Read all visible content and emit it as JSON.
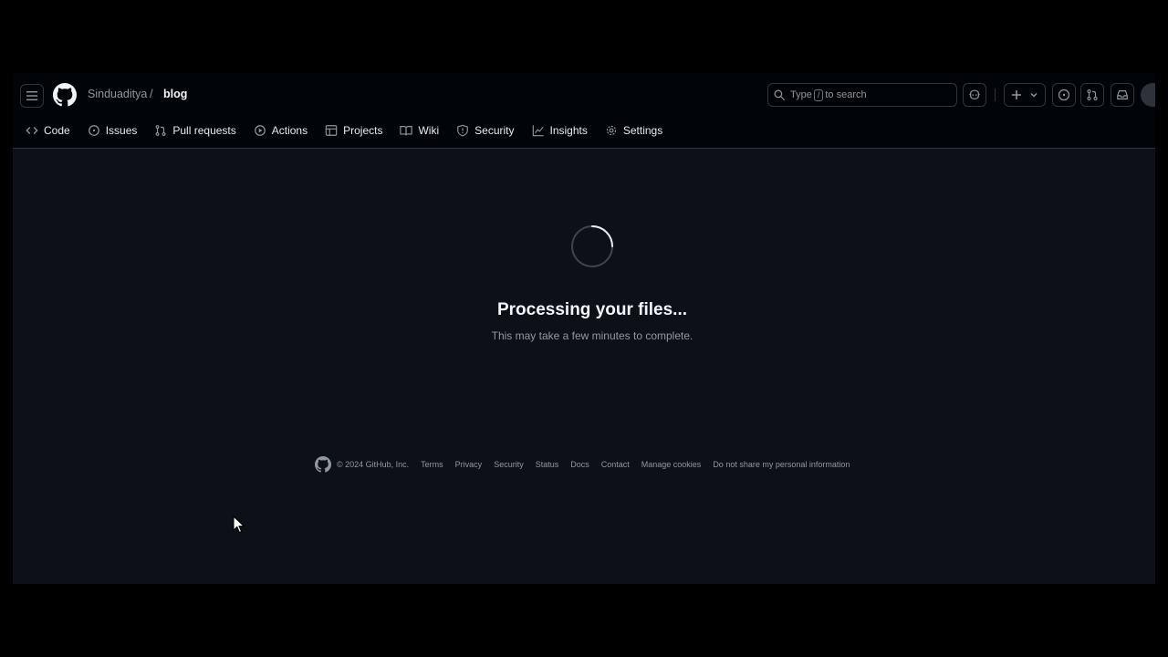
{
  "header": {
    "owner": "Sinduaditya",
    "separator": "/",
    "repo": "blog",
    "search": {
      "prefix": "Type",
      "key": "/",
      "suffix": "to search"
    }
  },
  "tabs": [
    {
      "label": "Code",
      "icon": "code-icon"
    },
    {
      "label": "Issues",
      "icon": "issue-icon"
    },
    {
      "label": "Pull requests",
      "icon": "pull-request-icon"
    },
    {
      "label": "Actions",
      "icon": "play-icon"
    },
    {
      "label": "Projects",
      "icon": "table-icon"
    },
    {
      "label": "Wiki",
      "icon": "book-icon"
    },
    {
      "label": "Security",
      "icon": "shield-icon"
    },
    {
      "label": "Insights",
      "icon": "graph-icon"
    },
    {
      "label": "Settings",
      "icon": "gear-icon"
    }
  ],
  "main": {
    "title": "Processing your files...",
    "subtitle": "This may take a few minutes to complete."
  },
  "footer": {
    "copyright": "© 2024 GitHub, Inc.",
    "links": [
      "Terms",
      "Privacy",
      "Security",
      "Status",
      "Docs",
      "Contact",
      "Manage cookies",
      "Do not share my personal information"
    ]
  },
  "colors": {
    "background": "#0d1117",
    "header_background": "#010409",
    "border": "#30363d",
    "muted_text": "#9198a1"
  }
}
